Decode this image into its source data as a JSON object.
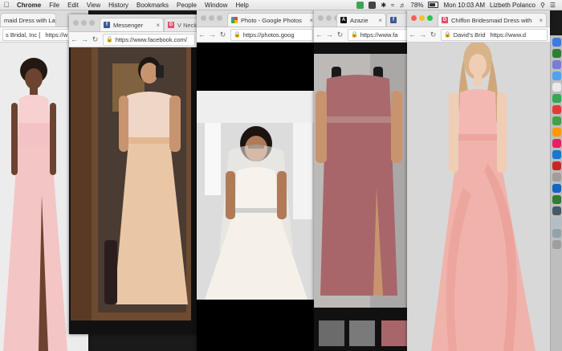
{
  "menubar": {
    "app_name": "Chrome",
    "items": [
      "File",
      "Edit",
      "View",
      "History",
      "Bookmarks",
      "People",
      "Window",
      "Help"
    ],
    "battery": "78%",
    "clock": "Mon 10:03 AM",
    "user": "Lizbeth Polanco"
  },
  "window1": {
    "tab_title": "maid Dress with La",
    "url_text": "s Bridal, Inc [",
    "url_host": "https://w"
  },
  "window2": {
    "tab1_title": "Messenger",
    "tab2_title": "V Neck",
    "url": "https://www.facebook.com/"
  },
  "window3": {
    "tab_title": "Photo - Google Photos",
    "url": "https://photos.goog"
  },
  "window4": {
    "tab_title": "Azazie",
    "url": "https://www.fa"
  },
  "window5": {
    "tab_title": "Chiffon Bridesmaid Dress with",
    "url_text": "David's Brid",
    "url_host": "https://www.d"
  },
  "colors": {
    "blush_dress": "#f4c5c5",
    "mauve_dress": "#a8666a",
    "champagne_dress": "#e9c7a6",
    "wedding_gown": "#f5f1ea",
    "pink_ruffle": "#f0b3ac"
  }
}
